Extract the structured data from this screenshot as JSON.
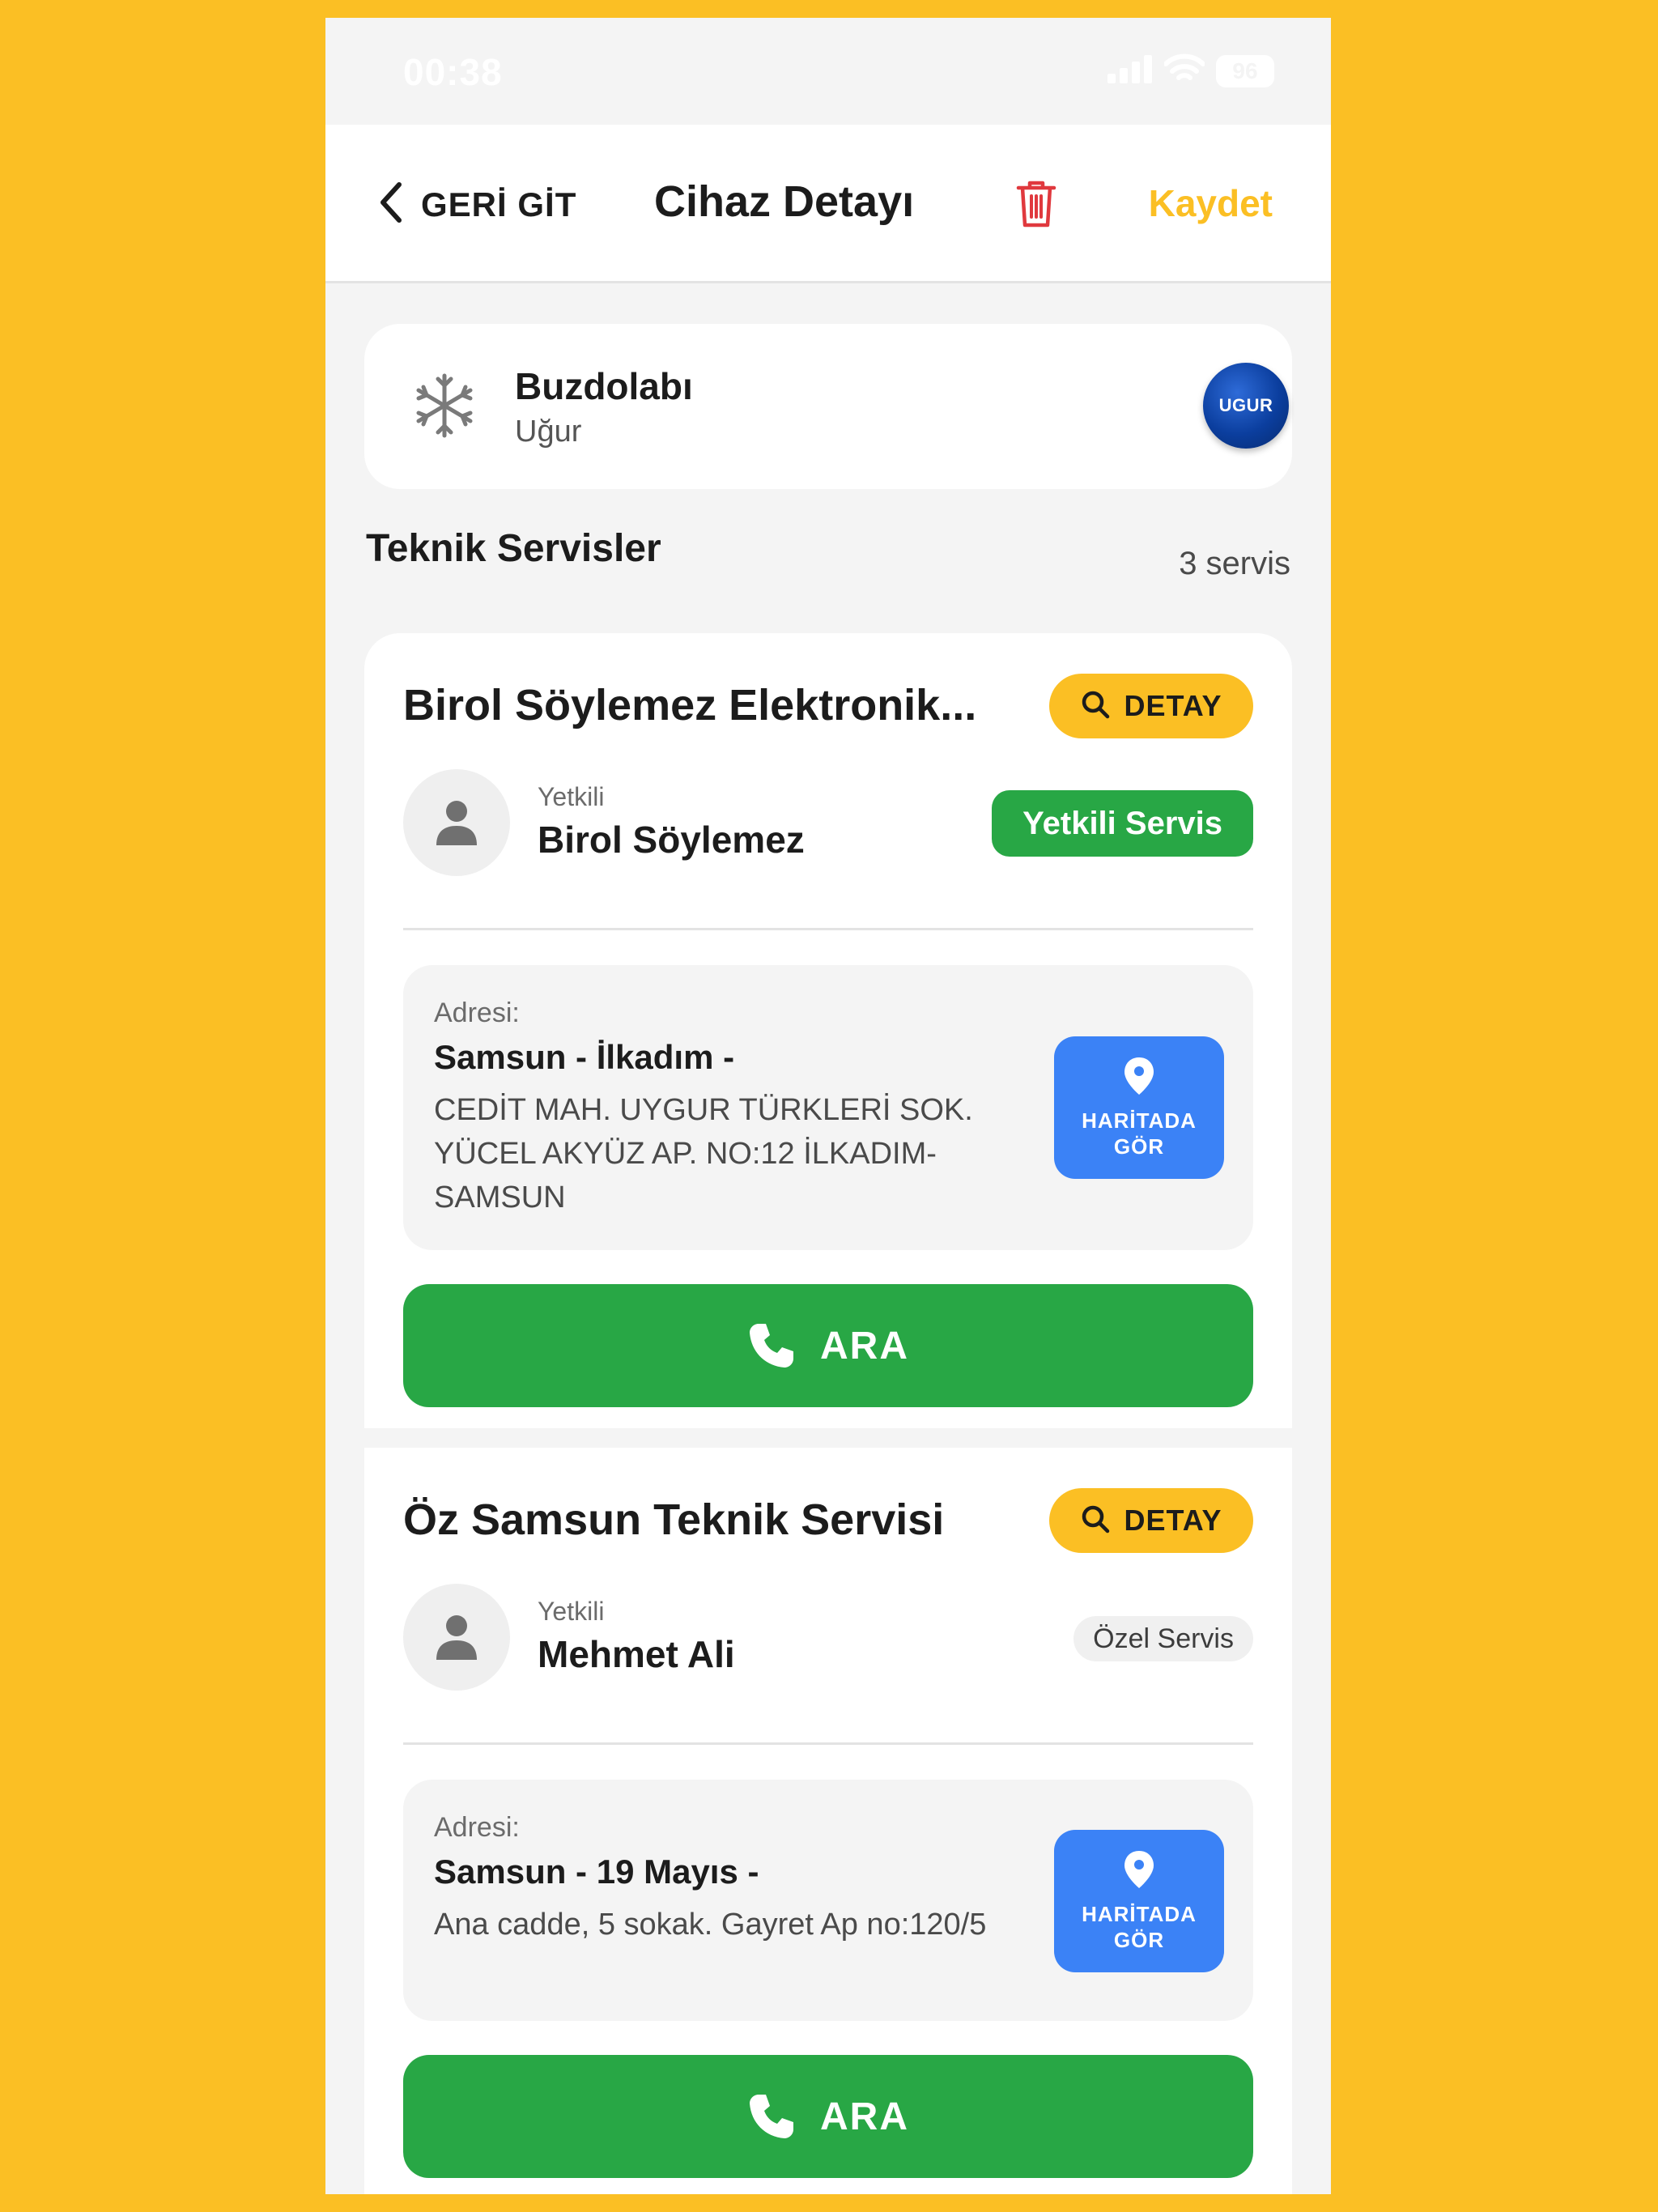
{
  "status_bar": {
    "time": "00:38",
    "battery": "96"
  },
  "header": {
    "back_label": "GERİ GİT",
    "title": "Cihaz Detayı",
    "save_label": "Kaydet"
  },
  "device": {
    "name": "Buzdolabı",
    "brand": "Uğur",
    "logo_text": "UGUR",
    "icon": "snowflake-icon"
  },
  "services_section": {
    "title": "Teknik Servisler",
    "count": "3 servis"
  },
  "services": [
    {
      "name": "Birol Söylemez Elektronik...",
      "detail_label": "DETAY",
      "contact_role": "Yetkili",
      "contact_name": "Birol Söylemez",
      "badge": "Yetkili Servis",
      "address_label": "Adresi:",
      "address_city": "Samsun - İlkadım -",
      "address_line": "CEDİT MAH. UYGUR TÜRKLERİ SOK. YÜCEL AKYÜZ AP. NO:12 İLKADIM-SAMSUN",
      "map_label": "HARİTADA GÖR",
      "call_label": "ARA"
    },
    {
      "name": "Öz Samsun Teknik Servisi",
      "detail_label": "DETAY",
      "contact_role": "Yetkili",
      "contact_name": "Mehmet Ali",
      "badge": "Özel Servis",
      "address_label": "Adresi:",
      "address_city": "Samsun - 19 Mayıs -",
      "address_line": "Ana cadde, 5 sokak. Gayret Ap no:120/5",
      "map_label": "HARİTADA GÖR",
      "call_label": "ARA"
    }
  ],
  "colors": {
    "background": "#FBBF24",
    "accent": "#FBBF24",
    "success": "#28A745",
    "map_button": "#3B82F6",
    "delete": "#E0393E"
  }
}
